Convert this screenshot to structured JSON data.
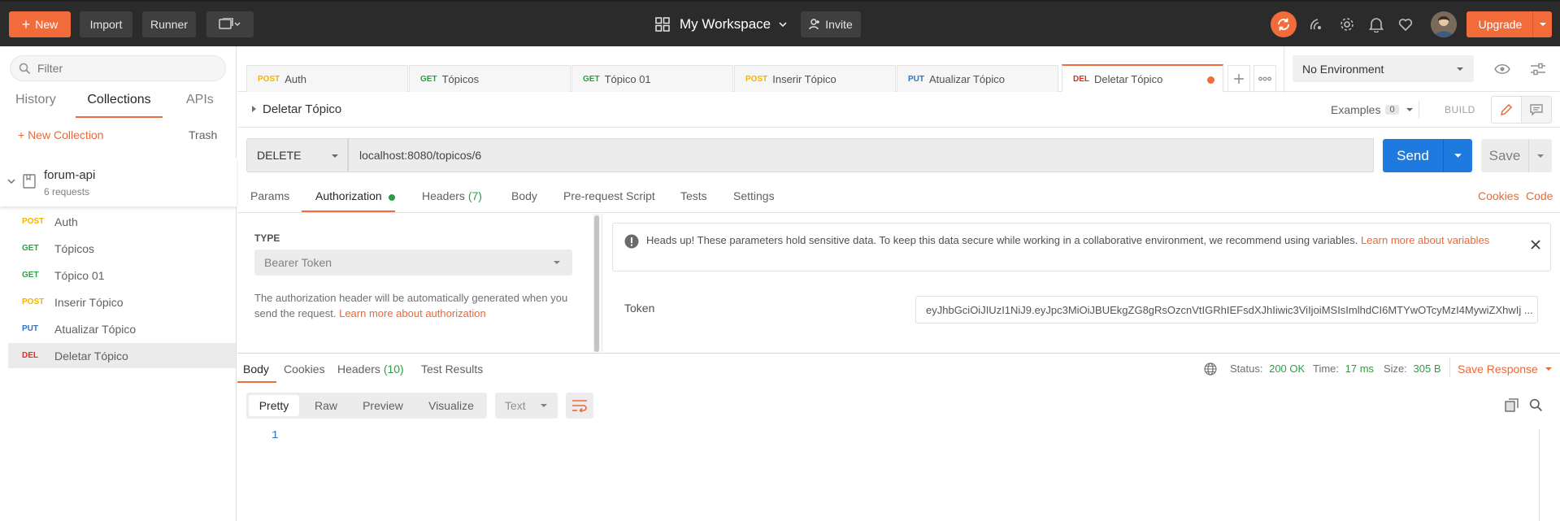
{
  "topbar": {
    "new_label": "New",
    "import_label": "Import",
    "runner_label": "Runner",
    "workspace_label": "My Workspace",
    "invite_label": "Invite",
    "upgrade_label": "Upgrade"
  },
  "sidebar": {
    "filter_placeholder": "Filter",
    "tabs": [
      "History",
      "Collections",
      "APIs"
    ],
    "new_collection_label": "+ New Collection",
    "trash_label": "Trash",
    "collection": {
      "name": "forum-api",
      "count": "6 requests"
    },
    "requests": [
      {
        "method": "POST",
        "name": "Auth"
      },
      {
        "method": "GET",
        "name": "Tópicos"
      },
      {
        "method": "GET",
        "name": "Tópico 01"
      },
      {
        "method": "POST",
        "name": "Inserir Tópico"
      },
      {
        "method": "PUT",
        "name": "Atualizar Tópico"
      },
      {
        "method": "DEL",
        "name": "Deletar Tópico"
      }
    ]
  },
  "tabs": [
    {
      "method": "POST",
      "name": "Auth"
    },
    {
      "method": "GET",
      "name": "Tópicos"
    },
    {
      "method": "GET",
      "name": "Tópico 01"
    },
    {
      "method": "POST",
      "name": "Inserir Tópico"
    },
    {
      "method": "PUT",
      "name": "Atualizar Tópico"
    },
    {
      "method": "DEL",
      "name": "Deletar Tópico"
    }
  ],
  "environment": {
    "selected": "No Environment"
  },
  "request": {
    "title": "Deletar Tópico",
    "examples_label": "Examples",
    "examples_count": "0",
    "build_label": "BUILD",
    "method": "DELETE",
    "url": "localhost:8080/topicos/6",
    "send_label": "Send",
    "save_label": "Save"
  },
  "request_tabs": {
    "params": "Params",
    "authorization": "Authorization",
    "headers": "Headers",
    "headers_count": "(7)",
    "body": "Body",
    "prerequest": "Pre-request Script",
    "tests": "Tests",
    "settings": "Settings",
    "cookies": "Cookies",
    "code": "Code"
  },
  "auth": {
    "type_label": "TYPE",
    "type_value": "Bearer Token",
    "description": "The authorization header will be automatically generated when you send the request.",
    "learn_more": "Learn more about authorization",
    "warning_text": "Heads up! These parameters hold sensitive data. To keep this data secure while working in a collaborative environment, we recommend using variables.",
    "warning_link_1": "Learn more about",
    "warning_link_2": "variables",
    "token_label": "Token",
    "token_value": "eyJhbGciOiJIUzI1NiJ9.eyJpc3MiOiJBUEkgZG8gRsOzcnVtIGRhIEFsdXJhIiwic3ViIjoiMSIsImlhdCI6MTYwOTcyMzI4MywiZXhwIj ..."
  },
  "response": {
    "tabs": {
      "body": "Body",
      "cookies": "Cookies",
      "headers": "Headers",
      "headers_count": "(10)",
      "tests": "Test Results"
    },
    "status_label": "Status:",
    "status_value": "200 OK",
    "time_label": "Time:",
    "time_value": "17 ms",
    "size_label": "Size:",
    "size_value": "305 B",
    "save_response": "Save Response",
    "format_buttons": [
      "Pretty",
      "Raw",
      "Preview",
      "Visualize"
    ],
    "format_type": "Text",
    "line_number": "1"
  }
}
